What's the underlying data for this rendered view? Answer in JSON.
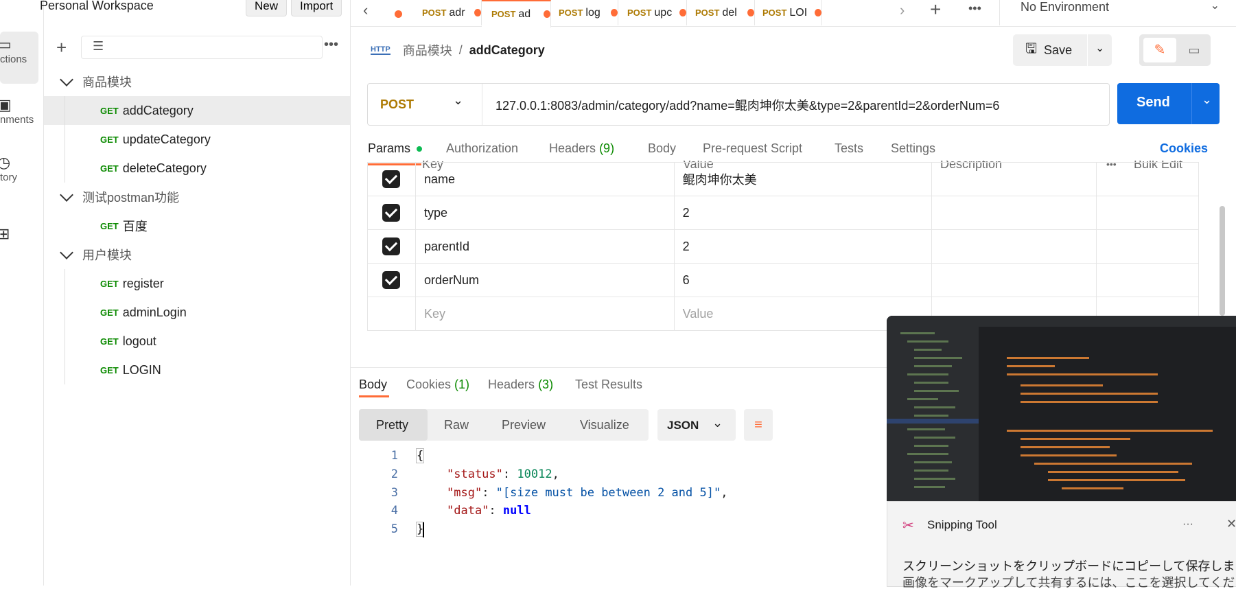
{
  "rail": {
    "items": [
      {
        "label": "ctions",
        "icon": "collections-icon"
      },
      {
        "label": "nments",
        "icon": "environments-icon"
      },
      {
        "label": "tory",
        "icon": "history-icon"
      },
      {
        "label": "",
        "icon": "apps-icon"
      }
    ]
  },
  "workspace": {
    "title": "Personal Workspace",
    "new_label": "New",
    "import_label": "Import"
  },
  "sidebar": {
    "items": [
      {
        "type": "folder",
        "label": "商品模块"
      },
      {
        "type": "req",
        "method": "GET",
        "label": "addCategory",
        "selected": true
      },
      {
        "type": "req",
        "method": "GET",
        "label": "updateCategory"
      },
      {
        "type": "req",
        "method": "GET",
        "label": "deleteCategory"
      },
      {
        "type": "folder",
        "label": "测试postman功能"
      },
      {
        "type": "req",
        "method": "GET",
        "label": "百度"
      },
      {
        "type": "folder",
        "label": "用户模块"
      },
      {
        "type": "req",
        "method": "GET",
        "label": "register"
      },
      {
        "type": "req",
        "method": "GET",
        "label": "adminLogin"
      },
      {
        "type": "req",
        "method": "GET",
        "label": "logout"
      },
      {
        "type": "req",
        "method": "GET",
        "label": "LOGIN"
      }
    ]
  },
  "tabs": [
    {
      "method": "POST",
      "label": "adr"
    },
    {
      "method": "POST",
      "label": "ad"
    },
    {
      "method": "POST",
      "label": "log"
    },
    {
      "method": "POST",
      "label": "upc"
    },
    {
      "method": "POST",
      "label": "del"
    },
    {
      "method": "POST",
      "label": "LOI"
    }
  ],
  "environment": "No Environment",
  "breadcrumb": {
    "parent": "商品模块",
    "sep": "/",
    "current": "addCategory",
    "icon_text": "HTTP"
  },
  "save_label": "Save",
  "request": {
    "method": "POST",
    "url": "127.0.0.1:8083/admin/category/add?name=鲲肉坤你太美&type=2&parentId=2&orderNum=6",
    "send_label": "Send"
  },
  "req_tabs": {
    "params": "Params",
    "authorization": "Authorization",
    "headers": "Headers",
    "headers_count": "(9)",
    "body": "Body",
    "prerequest": "Pre-request Script",
    "tests": "Tests",
    "settings": "Settings",
    "cookies": "Cookies"
  },
  "params": {
    "headers": {
      "key": "Key",
      "value": "Value",
      "description": "Description",
      "bulk": "Bulk Edit"
    },
    "rows": [
      {
        "key": "name",
        "value": "鲲肉坤你太美"
      },
      {
        "key": "type",
        "value": "2"
      },
      {
        "key": "parentId",
        "value": "2"
      },
      {
        "key": "orderNum",
        "value": "6"
      }
    ],
    "placeholder": {
      "key": "Key",
      "value": "Value"
    }
  },
  "response": {
    "tabs": {
      "body": "Body",
      "cookies": "Cookies",
      "cookies_count": "(1)",
      "headers": "Headers",
      "headers_count": "(3)",
      "tests": "Test Results"
    },
    "views": [
      "Pretty",
      "Raw",
      "Preview",
      "Visualize"
    ],
    "format": "JSON",
    "lines": [
      "1",
      "2",
      "3",
      "4",
      "5"
    ],
    "json": {
      "status_key": "\"status\"",
      "status_val": "10012",
      "msg_key": "\"msg\"",
      "msg_val": "\"[size must be between 2 and 5]\"",
      "data_key": "\"data\"",
      "data_val": "null"
    }
  },
  "snipping": {
    "title": "Snipping Tool",
    "line1": "スクリーンショットをクリップボードにコピーして保存しました",
    "line2": "画像をマークアップして共有するには、ここを選択してください"
  }
}
